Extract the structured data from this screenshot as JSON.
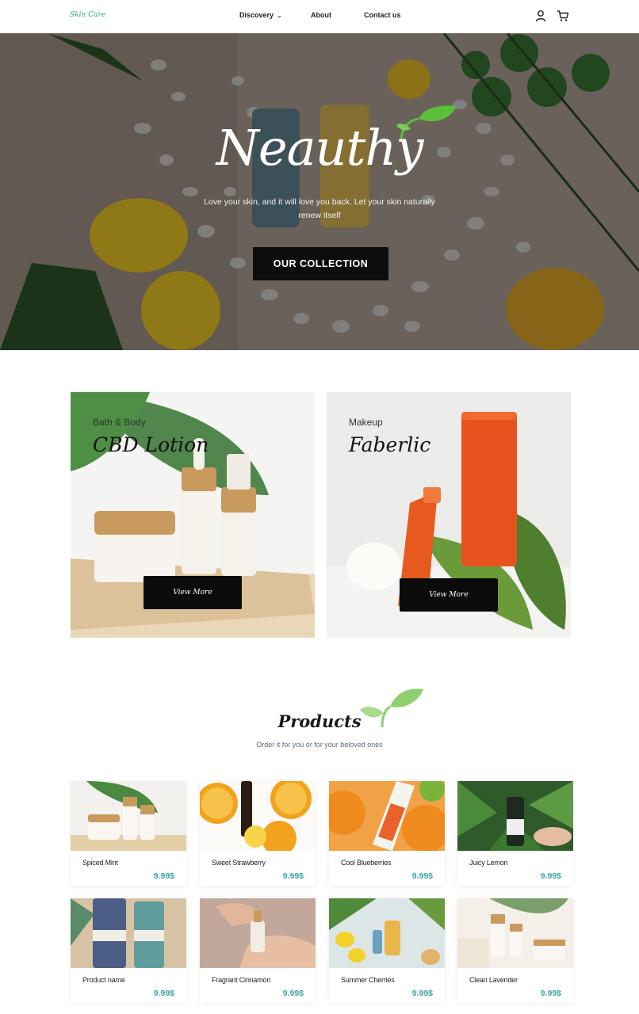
{
  "header": {
    "logo": "Skin Care",
    "nav": [
      {
        "label": "Discovery",
        "has_dropdown": true
      },
      {
        "label": "About"
      },
      {
        "label": "Contact us"
      }
    ],
    "icons": [
      "user-icon",
      "cart-icon"
    ]
  },
  "hero": {
    "brand": "Neauthy",
    "tagline": "Love your skin, and it will love you back. Let your skin naturally renew itself",
    "cta_label": "OUR COLLECTION"
  },
  "categories": [
    {
      "subtitle": "Bath & Body",
      "title": "CBD Lotion",
      "button": "View More"
    },
    {
      "subtitle": "Makeup",
      "title": "Faberlic",
      "button": "View More"
    }
  ],
  "products_section": {
    "title": "Products",
    "subtitle": "Order it for you or for your beloved ones"
  },
  "products": [
    {
      "name": "Spiced Mint",
      "price": "9.99$"
    },
    {
      "name": "Sweet Strawberry",
      "price": "9.99$"
    },
    {
      "name": "Cool Blueberries",
      "price": "9.99$"
    },
    {
      "name": "Juicy Lemon",
      "price": "9.99$"
    },
    {
      "name": "Product name",
      "price": "9.99$"
    },
    {
      "name": "Fragrant Cinnamon",
      "price": "9.99$"
    },
    {
      "name": "Summer Cherries",
      "price": "9.99$"
    },
    {
      "name": "Clean Lavender",
      "price": "9.99$"
    }
  ],
  "colors": {
    "accent_green": "#2aa87a",
    "price_teal": "#3aa6a0",
    "button_black": "#0d0d0d"
  }
}
